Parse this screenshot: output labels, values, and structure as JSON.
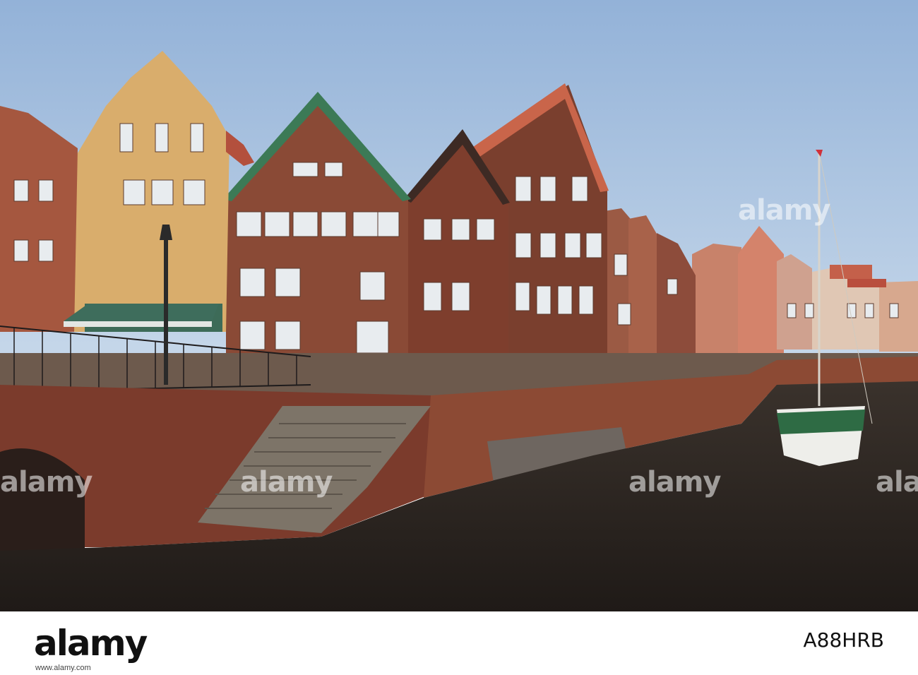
{
  "photo": {
    "colors": {
      "sky": "#a9c3e0",
      "brick": "#8c4a34",
      "water": "#2a2522",
      "green_trim": "#3f7a55"
    }
  },
  "watermarks": [
    "alamy",
    "alamy",
    "alamy",
    "alamy",
    "alamy"
  ],
  "footer": {
    "logo": "alamy",
    "image_id": "A88HRB",
    "url": "www.alamy.com"
  }
}
